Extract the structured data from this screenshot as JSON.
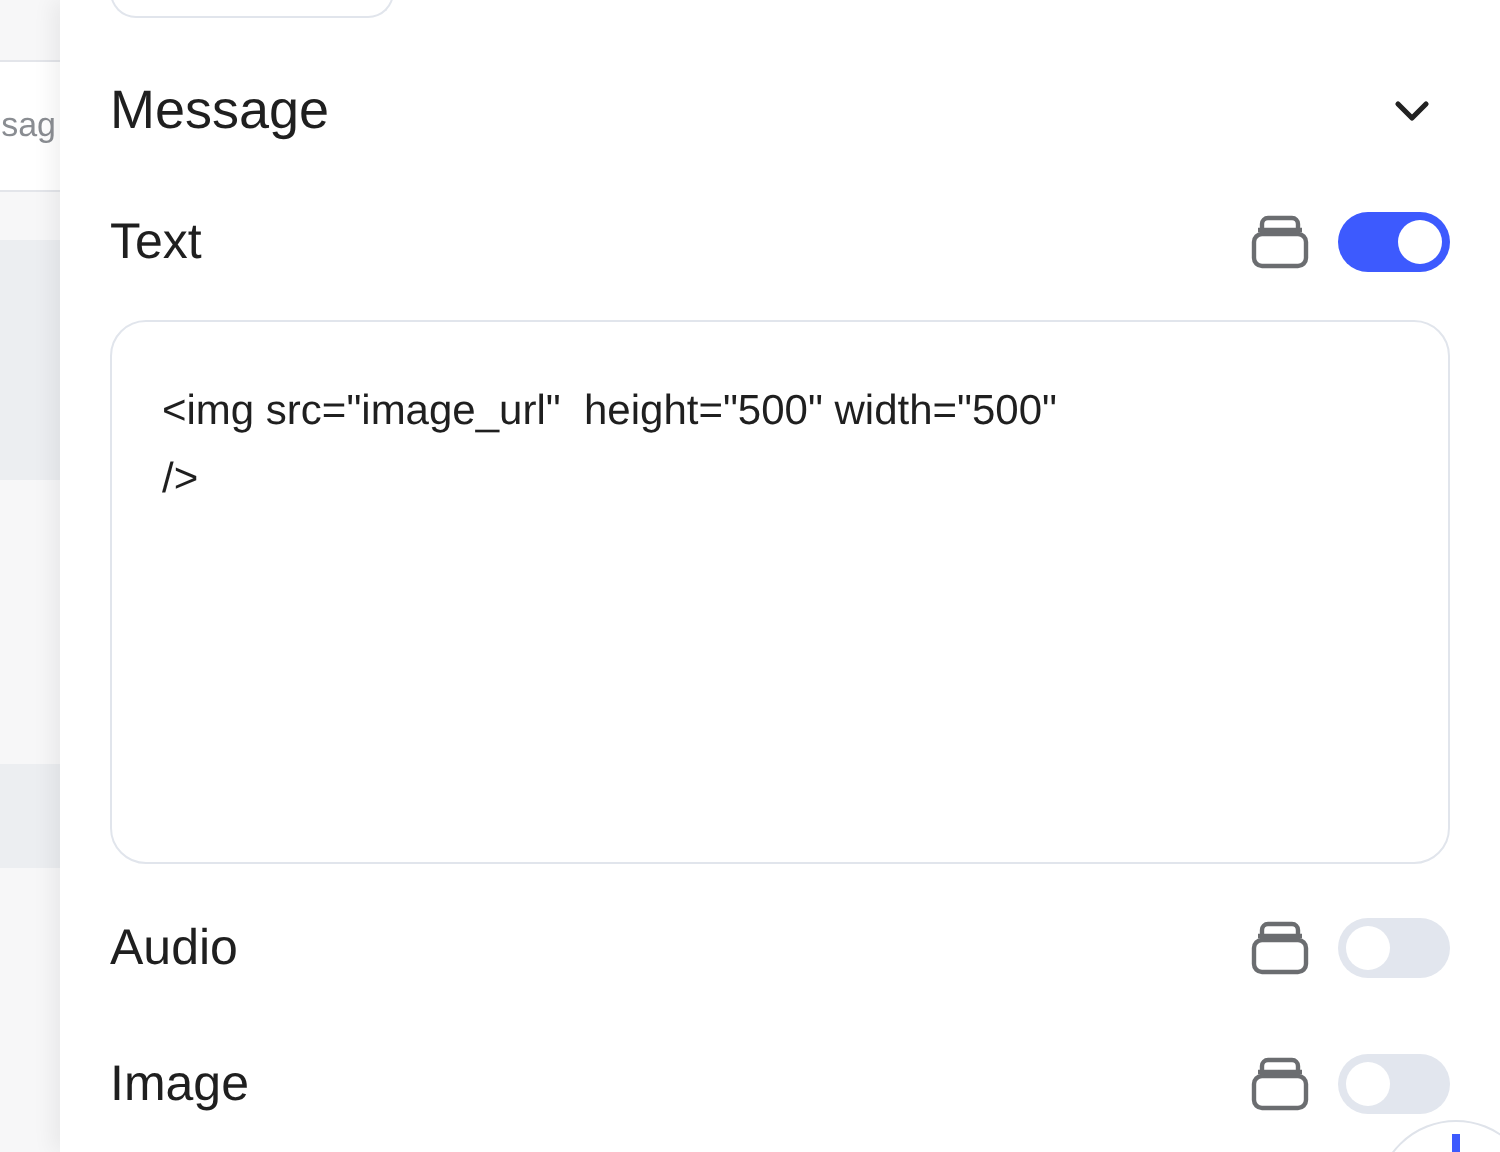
{
  "background_panel": {
    "tab_text": "sag"
  },
  "section": {
    "title": "Message",
    "expanded": true
  },
  "fields": [
    {
      "kind": "text",
      "label": "Text",
      "on": true,
      "value": "<img src=\"image_url\"  height=\"500\" width=\"500\" />"
    },
    {
      "kind": "toggle",
      "label": "Audio",
      "on": false
    },
    {
      "kind": "toggle",
      "label": "Image",
      "on": false
    }
  ]
}
